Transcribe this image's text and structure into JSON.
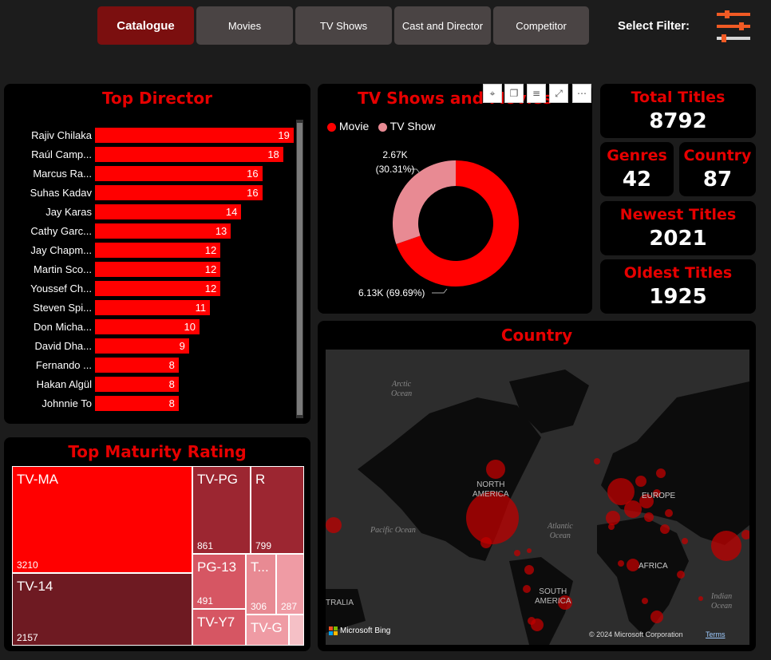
{
  "nav": {
    "buttons": [
      "Catalogue",
      "Movies",
      "TV Shows",
      "Cast and Director",
      "Competitor"
    ],
    "active": "Catalogue",
    "filter_label": "Select Filter:",
    "filter_icon": "sliders-icon"
  },
  "top_director": {
    "title": "Top Director",
    "rows": [
      {
        "name": "Rajiv Chilaka",
        "value": 19
      },
      {
        "name": "Raúl Camp...",
        "value": 18
      },
      {
        "name": "Marcus Ra...",
        "value": 16
      },
      {
        "name": "Suhas Kadav",
        "value": 16
      },
      {
        "name": "Jay Karas",
        "value": 14
      },
      {
        "name": "Cathy Garc...",
        "value": 13
      },
      {
        "name": "Jay Chapm...",
        "value": 12
      },
      {
        "name": "Martin Sco...",
        "value": 12
      },
      {
        "name": "Youssef Ch...",
        "value": 12
      },
      {
        "name": "Steven Spi...",
        "value": 11
      },
      {
        "name": "Don Micha...",
        "value": 10
      },
      {
        "name": "David Dha...",
        "value": 9
      },
      {
        "name": "Fernando ...",
        "value": 8
      },
      {
        "name": "Hakan Algül",
        "value": 8
      },
      {
        "name": "Johnnie To",
        "value": 8
      }
    ]
  },
  "tv_movie": {
    "title": "TV Shows and Movies",
    "legend": [
      {
        "name": "Movie",
        "color": "#ff0000"
      },
      {
        "name": "TV Show",
        "color": "#e88a93"
      }
    ],
    "movie_label": "6.13K (69.69%)",
    "tv_label_1": "2.67K",
    "tv_label_2": "(30.31%)",
    "toolbar_icons": [
      "pin-icon",
      "copy-icon",
      "filter-icon",
      "focus-mode-icon",
      "more-options-icon"
    ]
  },
  "kpis": {
    "total_titles": {
      "label": "Total Titles",
      "value": "8792"
    },
    "genres": {
      "label": "Genres",
      "value": "42"
    },
    "country": {
      "label": "Country",
      "value": "87"
    },
    "newest": {
      "label": "Newest Titles",
      "value": "2021"
    },
    "oldest": {
      "label": "Oldest Titles",
      "value": "1925"
    }
  },
  "maturity": {
    "title": "Top Maturity Rating",
    "items": [
      {
        "label": "TV-MA",
        "value": "3210",
        "color": "#ff0000"
      },
      {
        "label": "TV-14",
        "value": "2157",
        "color": "#6e1a22"
      },
      {
        "label": "TV-PG",
        "value": "861",
        "color": "#9c2631"
      },
      {
        "label": "R",
        "value": "799",
        "color": "#9c2631"
      },
      {
        "label": "PG-13",
        "value": "491",
        "color": "#d65663"
      },
      {
        "label": "T...",
        "value": "306",
        "color": "#e88a93"
      },
      {
        "label": "",
        "value": "287",
        "color": "#ef9ba4"
      },
      {
        "label": "TV-Y7",
        "value": "",
        "color": "#d65663"
      },
      {
        "label": "TV-G",
        "value": "",
        "color": "#ef9ba4"
      },
      {
        "label": "",
        "value": "",
        "color": "#f5c0c6"
      }
    ]
  },
  "country_map": {
    "title": "Country",
    "labels": {
      "arctic": [
        "Arctic",
        "Ocean"
      ],
      "north_america": [
        "NORTH",
        "AMERICA"
      ],
      "europe": "EUROPE",
      "pacific": "Pacific Ocean",
      "atlantic": [
        "Atlantic",
        "Ocean"
      ],
      "africa": "AFRICA",
      "south_america": [
        "SOUTH",
        "AMERICA"
      ],
      "indian": [
        "Indian",
        "Ocean"
      ],
      "australia": "TRALIA"
    },
    "bing": "Microsoft Bing",
    "copyright": "© 2024 Microsoft Corporation",
    "terms": "Terms"
  },
  "chart_data": [
    {
      "type": "bar",
      "title": "Top Director",
      "categories": [
        "Rajiv Chilaka",
        "Raúl Camp...",
        "Marcus Ra...",
        "Suhas Kadav",
        "Jay Karas",
        "Cathy Garc...",
        "Jay Chapm...",
        "Martin Sco...",
        "Youssef Ch...",
        "Steven Spi...",
        "Don Micha...",
        "David Dha...",
        "Fernando ...",
        "Hakan Algül",
        "Johnnie To"
      ],
      "values": [
        19,
        18,
        16,
        16,
        14,
        13,
        12,
        12,
        12,
        11,
        10,
        9,
        8,
        8,
        8
      ]
    },
    {
      "type": "pie",
      "title": "TV Shows and Movies",
      "categories": [
        "Movie",
        "TV Show"
      ],
      "values": [
        6130,
        2670
      ],
      "percent": [
        69.69,
        30.31
      ]
    }
  ]
}
